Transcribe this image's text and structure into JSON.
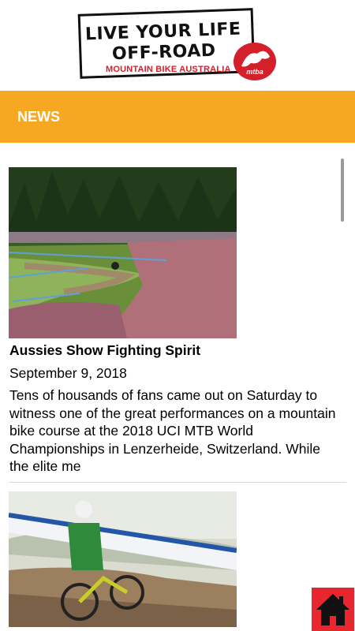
{
  "header": {
    "logo_line1": "LIVE YOUR LIFE",
    "logo_line2": "OFF-ROAD",
    "logo_subtitle": "MOUNTAIN BIKE AUSTRALIA",
    "logo_badge": "mtba",
    "brand_red": "#d4202a"
  },
  "section": {
    "title": "NEWS",
    "color": "#f7a823"
  },
  "articles": [
    {
      "title": "Aussies Show Fighting Spirit",
      "date": "September 9, 2018",
      "excerpt": "Tens of housands of fans came out on Saturday to witness one of the great performances on a mountain bike course at the 2018 UCI MTB World Championships in Lenzerheide, Switzerland. While the elite me"
    },
    {
      "title": "",
      "date": "",
      "excerpt": ""
    }
  ],
  "home_button": {
    "icon": "home-icon",
    "color": "#e8262d"
  }
}
